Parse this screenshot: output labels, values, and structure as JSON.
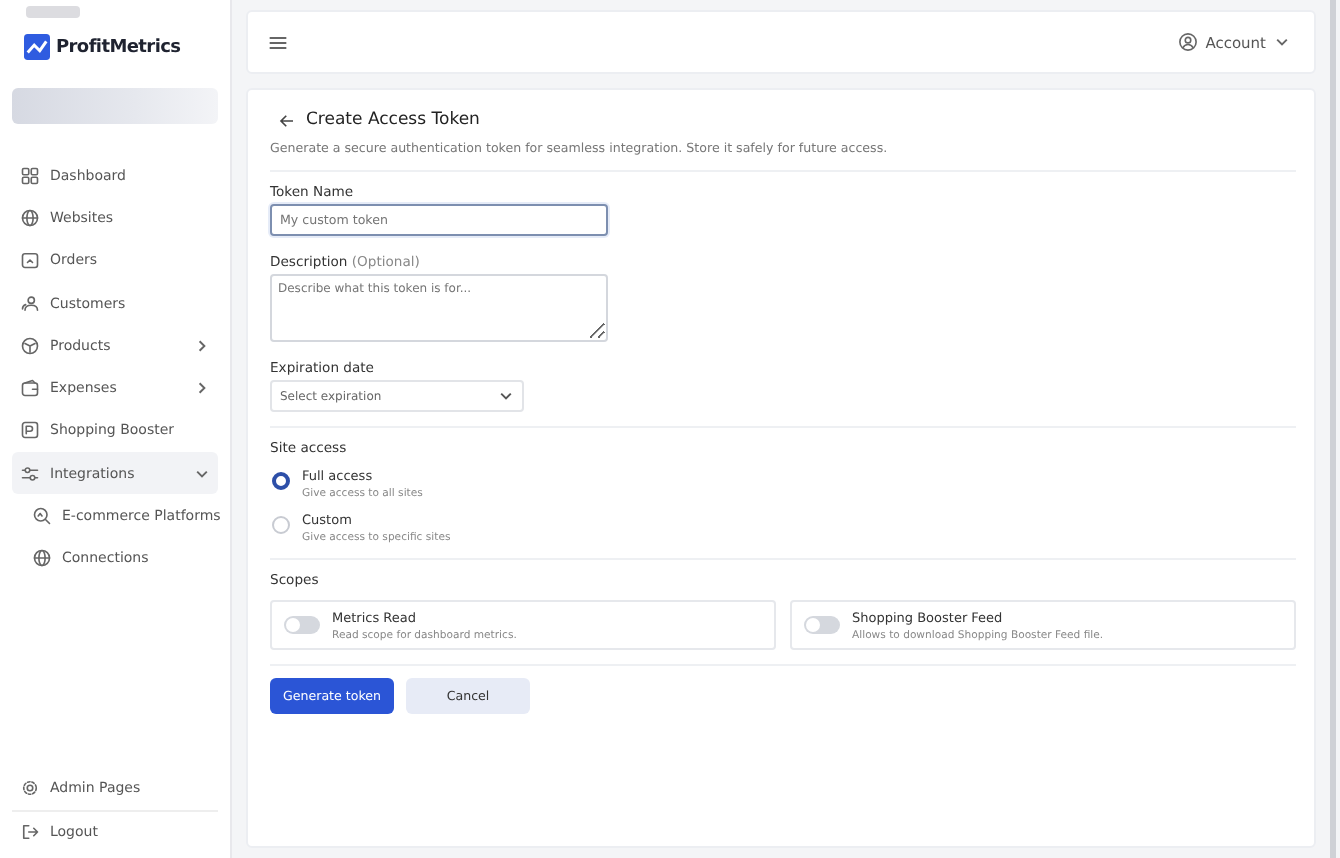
{
  "sidebar": {
    "brand": "ProfitMetrics",
    "items": [
      {
        "label": "Dashboard",
        "selected": false
      },
      {
        "label": "Websites",
        "selected": false
      },
      {
        "label": "Orders",
        "selected": false
      },
      {
        "label": "Customers",
        "selected": false
      },
      {
        "label": "Products",
        "selected": false,
        "expanded": false
      },
      {
        "label": "Expenses",
        "selected": false,
        "expanded": false
      },
      {
        "label": "Shopping Booster",
        "selected": false
      },
      {
        "label": "Integrations",
        "selected": true,
        "expanded": true,
        "children": [
          {
            "label": "E-commerce Platforms"
          },
          {
            "label": "Connections"
          }
        ]
      }
    ],
    "bottom_items": [
      {
        "label": "Admin Pages"
      },
      {
        "label": "Logout"
      }
    ]
  },
  "header": {
    "account": "Account"
  },
  "form": {
    "title": "Create Access Token",
    "subtitle": "Generate a secure authentication token for seamless integration. Store it safely for future access.",
    "token_name": {
      "label": "Token Name",
      "placeholder": "My custom token"
    },
    "description": {
      "label": "Description",
      "hint": "(Optional)",
      "placeholder": "Describe what this token is for..."
    },
    "expiration": {
      "label": "Expiration date",
      "placeholder": "Select expiration"
    },
    "site_access": {
      "label": "Site access",
      "options": [
        {
          "label": "Full access",
          "hint": "Give access to all sites",
          "selected": true
        },
        {
          "label": "Custom",
          "hint": "Give access to specific sites",
          "selected": false
        }
      ]
    },
    "scopes": {
      "label": "Scopes",
      "items": [
        {
          "label": "Metrics Read",
          "hint": "Read scope for dashboard metrics.",
          "on": false
        },
        {
          "label": "Shopping Booster Feed",
          "hint": "Allows to download Shopping Booster Feed file.",
          "on": false
        }
      ]
    },
    "buttons": [
      {
        "label": "Generate token",
        "kind": "primary"
      },
      {
        "label": "Cancel",
        "kind": "secondary"
      }
    ]
  }
}
